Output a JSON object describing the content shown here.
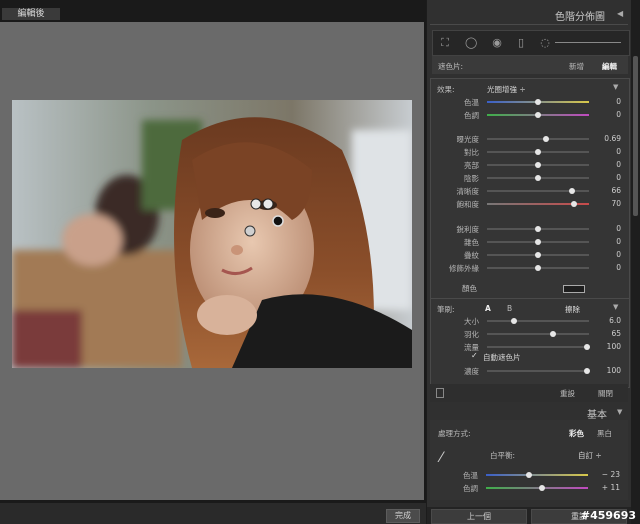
{
  "main": {
    "view_label": "編輯後",
    "done_button": "完成"
  },
  "panel": {
    "title": "色階分佈圖",
    "collapse_glyph": "◀",
    "mask": {
      "label": "遮色片:",
      "new": "新增",
      "edit": "編輯"
    },
    "effect": {
      "label": "效果:",
      "preset": "光圈增強 ÷",
      "sliders": [
        {
          "label": "色溫",
          "value": "0",
          "pos": 0.5,
          "gradient": "temp"
        },
        {
          "label": "色調",
          "value": "0",
          "pos": 0.5,
          "gradient": "tint"
        },
        {
          "label": "曝光度",
          "value": "0.69",
          "pos": 0.58,
          "gradient": "gray"
        },
        {
          "label": "對比",
          "value": "0",
          "pos": 0.5,
          "gradient": "gray"
        },
        {
          "label": "亮部",
          "value": "0",
          "pos": 0.5,
          "gradient": "gray"
        },
        {
          "label": "陰影",
          "value": "0",
          "pos": 0.5,
          "gradient": "gray"
        },
        {
          "label": "清晰度",
          "value": "66",
          "pos": 0.83,
          "gradient": "gray"
        },
        {
          "label": "飽和度",
          "value": "70",
          "pos": 0.85,
          "gradient": "sat"
        },
        {
          "label": "銳利度",
          "value": "0",
          "pos": 0.5,
          "gradient": "gray"
        },
        {
          "label": "雜色",
          "value": "0",
          "pos": 0.5,
          "gradient": "gray"
        },
        {
          "label": "疊紋",
          "value": "0",
          "pos": 0.5,
          "gradient": "gray"
        },
        {
          "label": "修飾外緣",
          "value": "0",
          "pos": 0.5,
          "gradient": "gray"
        }
      ],
      "color_label": "顏色"
    },
    "brush": {
      "label": "筆刷:",
      "a": "A",
      "b": "B",
      "erase": "擦除",
      "sliders": [
        {
          "label": "大小",
          "value": "6.0",
          "pos": 0.26
        },
        {
          "label": "羽化",
          "value": "65",
          "pos": 0.65
        },
        {
          "label": "流量",
          "value": "100",
          "pos": 0.98
        }
      ],
      "auto_mask": "自動遮色片",
      "density_label": "濃度",
      "density_value": "100",
      "density_pos": 0.98,
      "reset": "重設",
      "close": "關閉"
    },
    "basic": {
      "title": "基本",
      "treatment_label": "處理方式:",
      "color": "彩色",
      "bw": "黑白",
      "wb_label": "白平衡:",
      "wb_value": "自訂 ÷",
      "temp_label": "色溫",
      "temp_value": "− 23",
      "temp_pos": 0.42,
      "tint_label": "色調",
      "tint_value": "+ 11",
      "tint_pos": 0.55
    },
    "nav": {
      "prev": "上一個",
      "reset": "重設"
    }
  },
  "watermark": "#459693",
  "colors": {
    "panel_bg": "#303030",
    "canvas_bg": "#6a6a6a",
    "accent_white": "#ffffff"
  }
}
